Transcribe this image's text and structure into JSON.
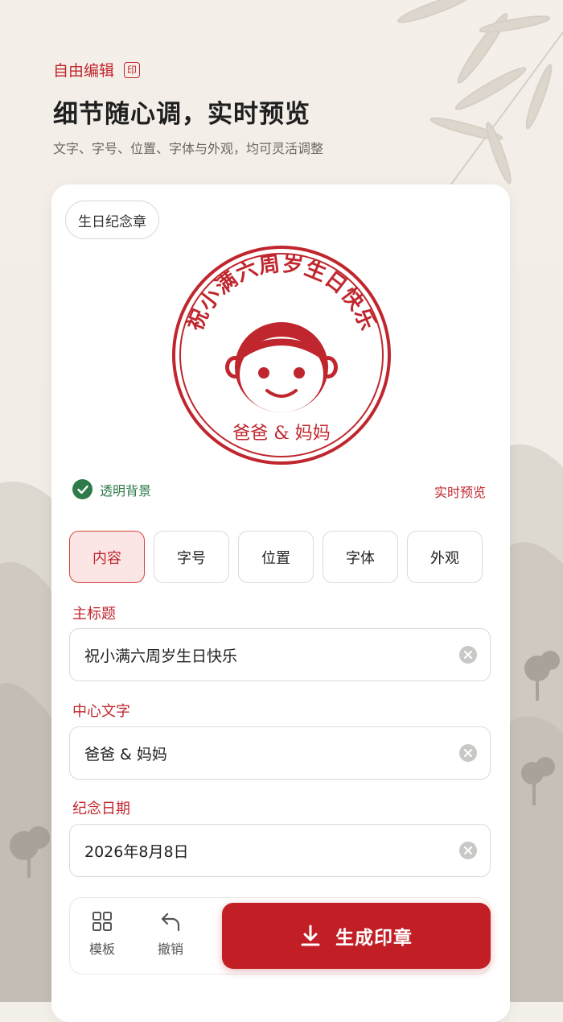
{
  "hero": {
    "tag": "自由编辑",
    "tag_icon_glyph": "印",
    "title": "细节随心调，实时预览",
    "subtitle": "文字、字号、位置、字体与外观，均可灵活调整"
  },
  "stamp": {
    "chip_label": "生日纪念章",
    "arc_text": "祝小满六周岁生日快乐",
    "center_text": "爸爸 & 妈妈",
    "color": "#c0262d"
  },
  "preview": {
    "transparent_label": "透明背景",
    "live_label": "实时预览"
  },
  "tabs": [
    {
      "label": "内容",
      "active": true
    },
    {
      "label": "字号",
      "active": false
    },
    {
      "label": "位置",
      "active": false
    },
    {
      "label": "字体",
      "active": false
    },
    {
      "label": "外观",
      "active": false
    }
  ],
  "form": {
    "title_label": "主标题",
    "title_value": "祝小满六周岁生日快乐",
    "center_label": "中心文字",
    "center_value": "爸爸 & 妈妈",
    "date_label": "纪念日期",
    "date_value": "2026年8月8日"
  },
  "toolbar": {
    "template_label": "模板",
    "undo_label": "撤销",
    "generate_label": "生成印章"
  },
  "colors": {
    "accent": "#c0262d",
    "success": "#2f7a4a",
    "button": "#c11f25"
  }
}
